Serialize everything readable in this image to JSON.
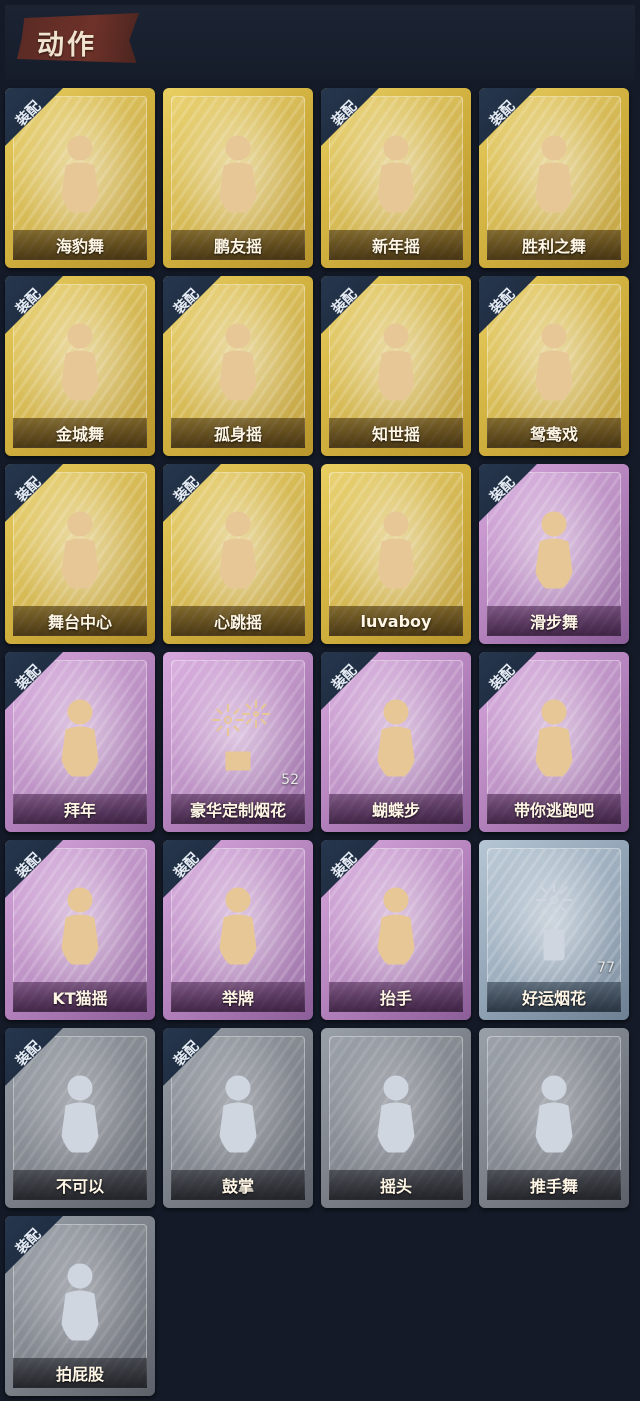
{
  "header": {
    "title": "动作"
  },
  "equip_label": "装配",
  "colors": {
    "gold": "#d2b240",
    "purple": "#b483bd",
    "blue": "#90a3b5",
    "grey": "#7c8189",
    "figure_gold": "#e7c796",
    "figure_silver": "#cfd6e0"
  },
  "emotes": [
    {
      "name": "海豹舞",
      "tier": "gold",
      "equipped": true,
      "icon": "dance-figure-icon"
    },
    {
      "name": "鹏友摇",
      "tier": "gold",
      "equipped": false,
      "icon": "dance-figure-icon"
    },
    {
      "name": "新年摇",
      "tier": "gold",
      "equipped": true,
      "icon": "dance-figure-icon"
    },
    {
      "name": "胜利之舞",
      "tier": "gold",
      "equipped": true,
      "icon": "dance-figure-icon"
    },
    {
      "name": "金城舞",
      "tier": "gold",
      "equipped": true,
      "icon": "dance-figure-icon"
    },
    {
      "name": "孤身摇",
      "tier": "gold",
      "equipped": true,
      "icon": "dance-figure-icon"
    },
    {
      "name": "知世摇",
      "tier": "gold",
      "equipped": true,
      "icon": "dance-figure-icon"
    },
    {
      "name": "鸳鸯戏",
      "tier": "gold",
      "equipped": true,
      "icon": "dance-figure-icon"
    },
    {
      "name": "舞台中心",
      "tier": "gold",
      "equipped": true,
      "icon": "dance-figure-icon"
    },
    {
      "name": "心跳摇",
      "tier": "gold",
      "equipped": true,
      "icon": "dance-figure-icon"
    },
    {
      "name": "luvaboy",
      "tier": "gold",
      "equipped": false,
      "icon": "dance-figure-icon"
    },
    {
      "name": "滑步舞",
      "tier": "purple",
      "equipped": true,
      "icon": "dance-figure-icon"
    },
    {
      "name": "拜年",
      "tier": "purple",
      "equipped": true,
      "icon": "bow-figure-icon"
    },
    {
      "name": "豪华定制烟花",
      "tier": "purple",
      "equipped": false,
      "icon": "firework-icon",
      "count": "52"
    },
    {
      "name": "蝴蝶步",
      "tier": "purple",
      "equipped": true,
      "icon": "dance-figure-icon"
    },
    {
      "name": "带你逃跑吧",
      "tier": "purple",
      "equipped": true,
      "icon": "dance-figure-icon"
    },
    {
      "name": "KT猫摇",
      "tier": "purple",
      "equipped": true,
      "icon": "dance-figure-icon"
    },
    {
      "name": "举牌",
      "tier": "purple",
      "equipped": true,
      "icon": "sign-figure-icon"
    },
    {
      "name": "抬手",
      "tier": "purple",
      "equipped": true,
      "icon": "raise-hand-figure-icon"
    },
    {
      "name": "好运烟花",
      "tier": "blue",
      "equipped": false,
      "icon": "firework-can-icon",
      "count": "77"
    },
    {
      "name": "不可以",
      "tier": "grey",
      "equipped": true,
      "icon": "finger-wag-icon"
    },
    {
      "name": "鼓掌",
      "tier": "grey",
      "equipped": true,
      "icon": "clap-hands-icon"
    },
    {
      "name": "摇头",
      "tier": "grey",
      "equipped": false,
      "icon": "shake-head-figure-icon"
    },
    {
      "name": "推手舞",
      "tier": "grey",
      "equipped": false,
      "icon": "push-hands-figure-icon"
    },
    {
      "name": "拍屁股",
      "tier": "grey",
      "equipped": true,
      "icon": "spank-figure-icon"
    }
  ]
}
